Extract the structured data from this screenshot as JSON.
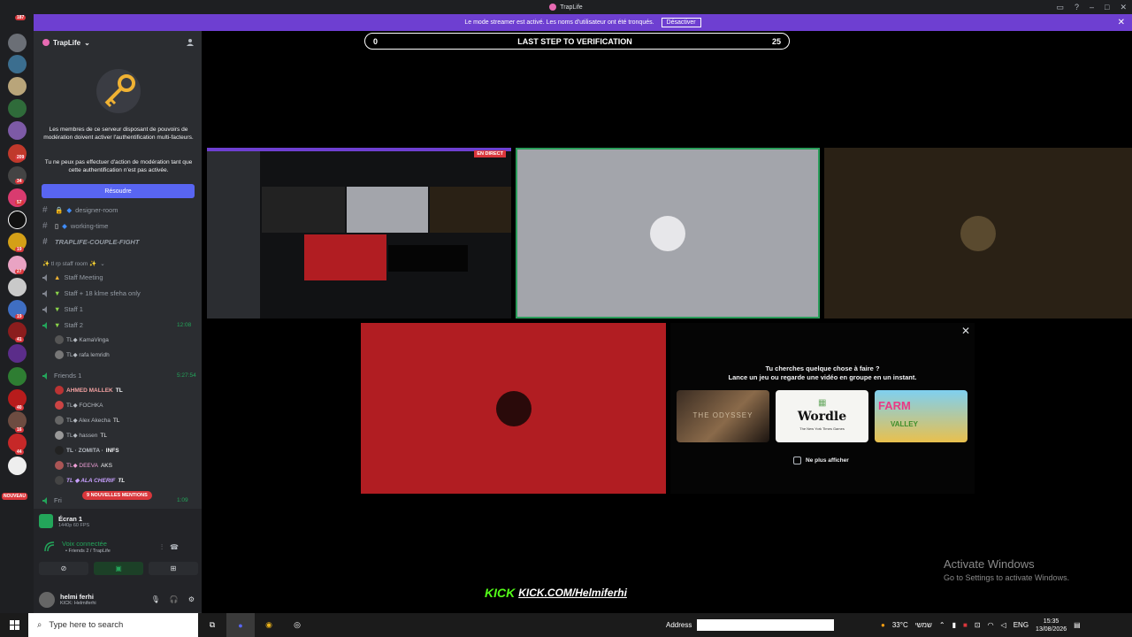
{
  "window": {
    "title": "TrapLife"
  },
  "banner": {
    "message": "Le mode streamer est activé. Les noms d'utilisateur ont été tronqués.",
    "action": "Désactiver"
  },
  "rail": {
    "badges": [
      "187",
      "209",
      "34",
      "57",
      "19",
      "27",
      "41",
      "19",
      "40",
      "16",
      "44"
    ],
    "nouveau_label": "NOUVEAU"
  },
  "server": {
    "name": "TrapLife",
    "mfa_line1": "Les membres de ce serveur disposant de pouvoirs de modération doivent activer l'authentification multi-facteurs.",
    "mfa_line2": "Tu ne peux pas effectuer d'action de modération tant que cette authentification n'est pas activée.",
    "resolve_label": "Résoudre"
  },
  "channels": {
    "text": [
      "designer-room",
      "working-time",
      "TRAPLIFE-COUPLE-FIGHT"
    ],
    "category": "✨ tl rp staff room ✨",
    "voice": [
      {
        "name": "Staff Meeting",
        "time": ""
      },
      {
        "name": "Staff + 18 klme sfeha only",
        "time": ""
      },
      {
        "name": "Staff 1",
        "time": ""
      },
      {
        "name": "Staff 2",
        "time": "12:08"
      },
      {
        "name": "Friends 1",
        "time": "5:27:54"
      },
      {
        "name": "Fri",
        "time": "1:09"
      }
    ],
    "staff2_users": [
      "TL◆ KamaVinga",
      "TL◆ rafa lemridh"
    ],
    "friends1_users": [
      "AHMED MALLEK",
      "TL◆ FOCHKA",
      "TL◆ Alex Akecha",
      "TL◆ hassen",
      "TL · ZOMITA ·",
      "TL◆ DEEVA",
      "TL ◆ ALA CHERIF"
    ],
    "friends1_tags": [
      "TL",
      "",
      "TL",
      "TL",
      "INFS",
      "AKS",
      "TL"
    ],
    "mentions_label": "9 NOUVELLES MENTIONS"
  },
  "voice_panel": {
    "screen_title": "Écran 1",
    "screen_sub": "1440p 60 FPS",
    "connected_label": "Voix connectée",
    "connected_sub": "• Friends 2 / TrapLife"
  },
  "user": {
    "name": "helmi ferhi",
    "status": "KICK: Helmiferhi"
  },
  "stage": {
    "verif_left": "0",
    "verif_title": "LAST STEP TO VERIFICATION",
    "verif_right": "25",
    "live_label": "EN DIRECT"
  },
  "activity": {
    "title_line1": "Tu cherches quelque chose à faire ?",
    "title_line2": "Lance un jeu ou regarde une vidéo en groupe en un instant.",
    "cards": [
      "THE ODYSSEY",
      "Wordle",
      "FARM",
      "VALLEY"
    ],
    "wordle_sub": "The New York Times Games",
    "no_show": "Ne plus afficher"
  },
  "windows_watermark": {
    "line1": "Activate Windows",
    "line2": "Go to Settings to activate Windows."
  },
  "kick": {
    "label": "KICK",
    "url": "KICK.COM/Helmiferhi"
  },
  "taskbar": {
    "search_placeholder": "Type here to search",
    "address_label": "Address",
    "weather": "33°C",
    "weather_desc": "שמשי",
    "lang": "ENG",
    "time": "15:35",
    "date": "13/08/2026"
  },
  "colors": {
    "accent": "#5865f2",
    "banner": "#6e3fd1",
    "online": "#23a55a",
    "danger": "#da373c",
    "kick_green": "#53fc18"
  }
}
